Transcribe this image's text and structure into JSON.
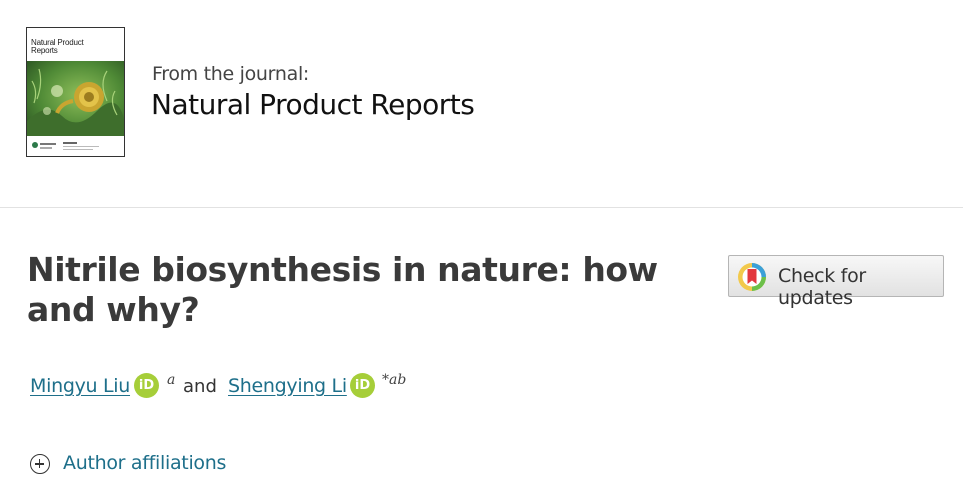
{
  "journal": {
    "cover_title": "Natural Product Reports",
    "from_label": "From the journal:",
    "name": "Natural Product Reports"
  },
  "article": {
    "title": "Nitrile biosynthesis in nature: how and why?"
  },
  "check_updates": {
    "label": "Check for updates",
    "icon": "crossmark-icon"
  },
  "authors": [
    {
      "name": "Mingyu Liu",
      "orcid_label": "iD",
      "superscript": "a"
    },
    {
      "name": "Shengying Li",
      "orcid_label": "iD",
      "superscript": "*ab"
    }
  ],
  "authors_joiner": "and",
  "affiliations": {
    "label": "Author affiliations",
    "icon": "plus-circle-icon"
  },
  "colors": {
    "link": "#1e6f8a",
    "orcid": "#a6ce39",
    "title": "#3a3a3a",
    "divider": "#e2e2e2"
  }
}
